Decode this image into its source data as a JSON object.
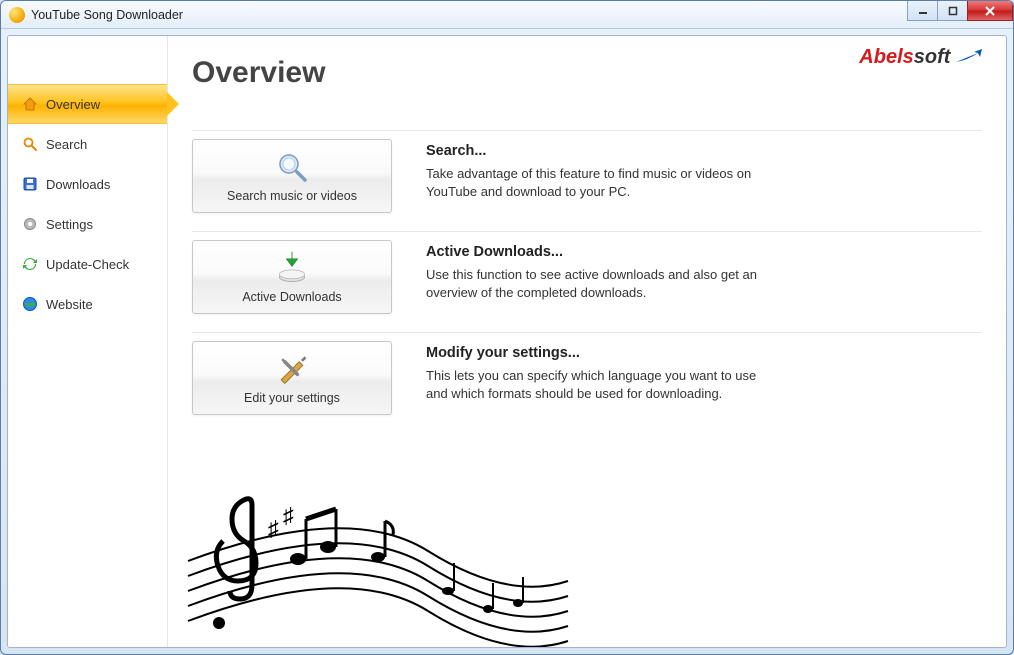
{
  "window": {
    "title": "YouTube Song Downloader"
  },
  "brand": {
    "prefix": "Abels",
    "suffix": "soft"
  },
  "page": {
    "title": "Overview"
  },
  "sidebar": {
    "items": [
      {
        "label": "Overview"
      },
      {
        "label": "Search"
      },
      {
        "label": "Downloads"
      },
      {
        "label": "Settings"
      },
      {
        "label": "Update-Check"
      },
      {
        "label": "Website"
      }
    ]
  },
  "sections": [
    {
      "button_label": "Search music or videos",
      "title": "Search...",
      "body": "Take advantage of this feature to find music or videos on YouTube and download to your PC."
    },
    {
      "button_label": "Active Downloads",
      "title": "Active Downloads...",
      "body": "Use this function to see active downloads and also get an overview of the completed downloads."
    },
    {
      "button_label": "Edit your settings",
      "title": "Modify your settings...",
      "body": "This lets you can specify which language you want to use and which formats should be used for downloading."
    }
  ]
}
